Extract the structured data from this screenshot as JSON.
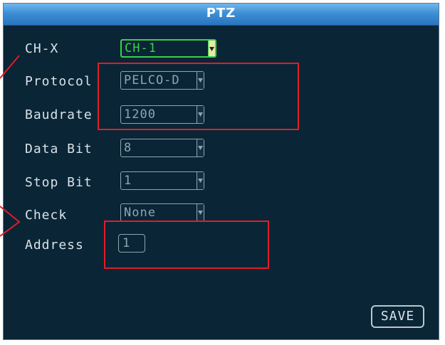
{
  "window": {
    "title": "PTZ"
  },
  "form": {
    "channel": {
      "label": "CH-X",
      "value": "CH-1"
    },
    "protocol": {
      "label": "Protocol",
      "value": "PELCO-D"
    },
    "baudrate": {
      "label": "Baudrate",
      "value": "1200"
    },
    "data_bit": {
      "label": "Data Bit",
      "value": "8"
    },
    "stop_bit": {
      "label": "Stop Bit",
      "value": "1"
    },
    "check": {
      "label": "Check",
      "value": "None"
    },
    "address": {
      "label": "Address",
      "value": "1"
    }
  },
  "actions": {
    "save_label": "SAVE"
  },
  "colors": {
    "background": "#0a2536",
    "title_bar": "#3d8fd6",
    "active_field": "#39d14b",
    "annotation": "#e21d26"
  }
}
